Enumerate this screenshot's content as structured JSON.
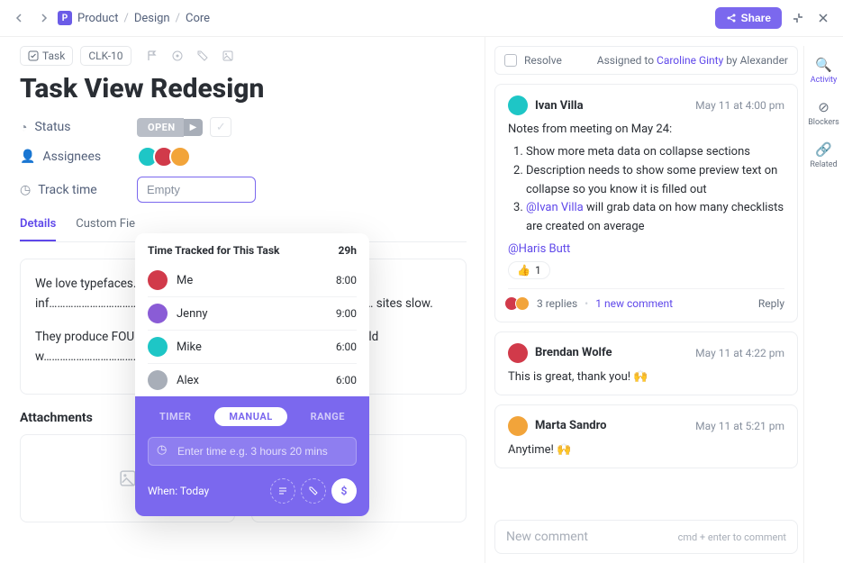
{
  "breadcrumb": {
    "icon_letter": "P",
    "items": [
      "Product",
      "Design",
      "Core"
    ]
  },
  "topbar": {
    "share": "Share"
  },
  "task": {
    "type_label": "Task",
    "id": "CLK-10",
    "title": "Task View Redesign",
    "status_label": "Status",
    "status_value": "OPEN",
    "assignees_label": "Assignees",
    "track_label": "Track time",
    "track_value": "Empty"
  },
  "assignee_colors": [
    "#1ec6c6",
    "#d13a4a",
    "#f2a43a"
  ],
  "tabs": {
    "details": "Details",
    "custom": "Custom Fie"
  },
  "description": {
    "p1": "We love typefaces. …………………………………d feel. They convey the inf…………………………………ion hierarchy. But they'……………………………… sites slow.",
    "p2": "They produce FOU\"……………………………………table ways. Why should w…………………………………n the"
  },
  "attachments_title": "Attachments",
  "popover": {
    "title": "Time Tracked for This Task",
    "total": "29h",
    "rows": [
      {
        "name": "Me",
        "time": "8:00",
        "color": "#d13a4a"
      },
      {
        "name": "Jenny",
        "time": "9:00",
        "color": "#8a5cd6"
      },
      {
        "name": "Mike",
        "time": "6:00",
        "color": "#1ec6c6"
      },
      {
        "name": "Alex",
        "time": "6:00",
        "color": "#a8aeb8"
      }
    ],
    "seg": {
      "timer": "TIMER",
      "manual": "MANUAL",
      "range": "RANGE"
    },
    "placeholder": "Enter time e.g. 3 hours 20 mins",
    "when": "When: Today",
    "dollar": "$"
  },
  "right": {
    "resolve": "Resolve",
    "assigned_prefix": "Assigned to ",
    "assigned_name": "Caroline Ginty",
    "assigned_by": " by Alexander"
  },
  "comments": [
    {
      "author": "Ivan Villa",
      "avatar": "#1ec6c6",
      "time": "May 11 at 4:00 pm",
      "lead": "Notes from meeting on May 24:",
      "items": [
        "Show more meta data on collapse sections",
        "Description needs to show some preview text on collapse so you know it is filled out"
      ],
      "item3_mention": "@Ivan Villa",
      "item3_rest": " will grab data on how many checklists are created on average",
      "mention2": "@Haris Butt",
      "reaction_emoji": "👍",
      "reaction_count": "1",
      "replies_count": "3 replies",
      "new_comment": "1 new comment",
      "reply_label": "Reply"
    },
    {
      "author": "Brendan Wolfe",
      "avatar": "#d13a4a",
      "time": "May 11 at 4:22 pm",
      "text": "This is great, thank you! 🙌"
    },
    {
      "author": "Marta Sandro",
      "avatar": "#f2a43a",
      "time": "May 11 at 5:21 pm",
      "text": "Anytime! 🙌"
    }
  ],
  "composer": {
    "placeholder": "New comment",
    "hint": "cmd + enter to comment"
  },
  "rail": {
    "activity": "Activity",
    "blockers": "Blockers",
    "related": "Related"
  }
}
